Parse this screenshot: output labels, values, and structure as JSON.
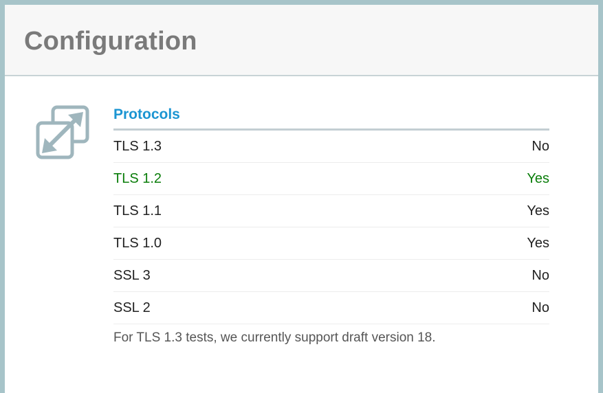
{
  "header": {
    "title": "Configuration"
  },
  "section": {
    "icon": "expand-arrows-icon",
    "heading": "Protocols",
    "rows": [
      {
        "name": "TLS 1.3",
        "value": "No",
        "highlight": false
      },
      {
        "name": "TLS 1.2",
        "value": "Yes",
        "highlight": true
      },
      {
        "name": "TLS 1.1",
        "value": "Yes",
        "highlight": false
      },
      {
        "name": "TLS 1.0",
        "value": "Yes",
        "highlight": false
      },
      {
        "name": "SSL 3",
        "value": "No",
        "highlight": false
      },
      {
        "name": "SSL 2",
        "value": "No",
        "highlight": false
      }
    ],
    "footnote": "For TLS 1.3 tests, we currently support draft version 18."
  },
  "colors": {
    "background": "#a7c4c9",
    "heading": "#1b95d2",
    "title": "#7a7a7a",
    "highlight": "#0a7d0a",
    "icon": "#9fb6bd"
  }
}
